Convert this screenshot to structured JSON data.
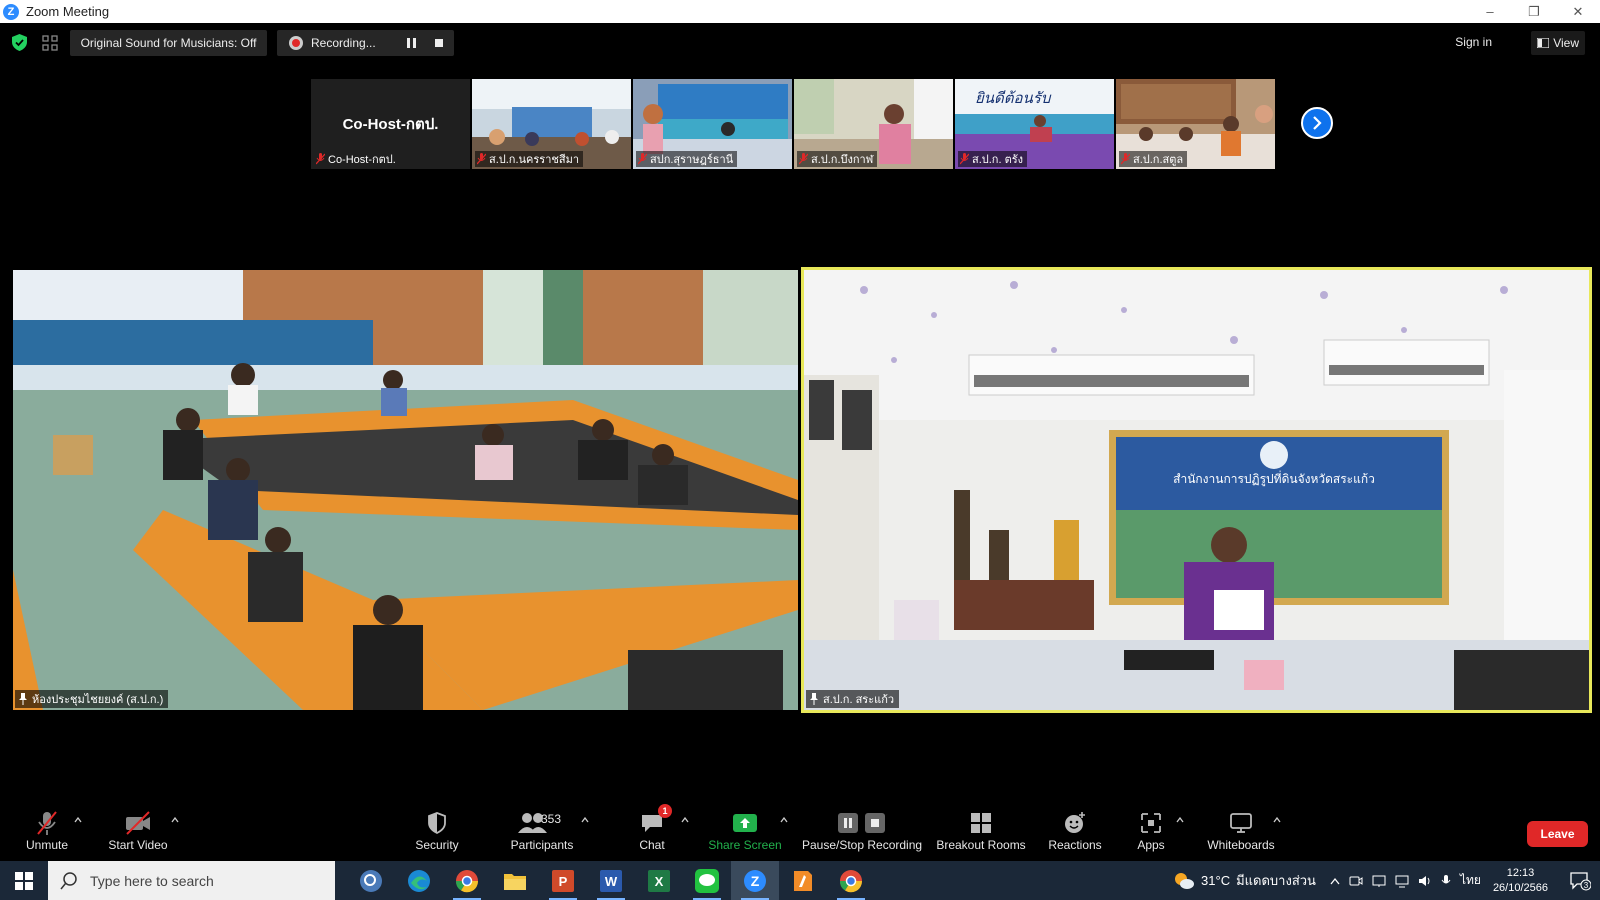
{
  "window": {
    "app_icon": "Z",
    "title": "Zoom Meeting",
    "controls": [
      "minimize",
      "restore",
      "close"
    ]
  },
  "topbar": {
    "sound_label": "Original Sound for Musicians: Off",
    "recording_label": "Recording...",
    "signin_label": "Sign in",
    "view_label": "View"
  },
  "thumbnails": [
    {
      "name": "Co-Host-กตป.",
      "center_text": "Co-Host-กตป.",
      "muted": true
    },
    {
      "name": "ส.ป.ก.นครราชสีมา",
      "muted": true
    },
    {
      "name": "สปก.สุราษฎร์ธานี",
      "muted": true
    },
    {
      "name": "ส.ป.ก.บึงกาฬ",
      "muted": true
    },
    {
      "name": "ส.ป.ก. ตรัง",
      "muted": true,
      "banner_text": "ยินดีต้อนรับ"
    },
    {
      "name": "ส.ป.ก.สตูล",
      "muted": true
    }
  ],
  "main_videos": {
    "left": {
      "name": "ห้องประชุมไชยยงค์ (ส.ป.ก.)"
    },
    "right": {
      "name": "ส.ป.ก. สระแก้ว",
      "banner_text": "สำนักงานการปฏิรูปที่ดินจังหวัดสระแก้ว",
      "active_speaker": true
    }
  },
  "toolbar": {
    "unmute": "Unmute",
    "start_video": "Start Video",
    "security": "Security",
    "participants": "Participants",
    "participants_count": "353",
    "chat": "Chat",
    "chat_badge": "1",
    "share_screen": "Share Screen",
    "pause_stop": "Pause/Stop Recording",
    "breakout": "Breakout Rooms",
    "reactions": "Reactions",
    "apps": "Apps",
    "whiteboards": "Whiteboards",
    "leave": "Leave"
  },
  "taskbar": {
    "search_placeholder": "Type here to search",
    "apps": [
      "search-app-icon",
      "edge-icon",
      "chrome-icon",
      "file-explorer-icon",
      "powerpoint-icon",
      "word-icon",
      "excel-icon",
      "line-icon",
      "zoom-icon",
      "app-icon",
      "chrome-icon"
    ],
    "weather_temp": "31°C",
    "weather_text": "มีแดดบางส่วน",
    "lang": "ไทย",
    "time": "12:13",
    "date": "26/10/2566",
    "notification_count": "3"
  },
  "colors": {
    "accent": "#2d8cff",
    "leave": "#e02828",
    "active_speaker_border": "#e8e85a",
    "share_green": "#22b14c"
  }
}
